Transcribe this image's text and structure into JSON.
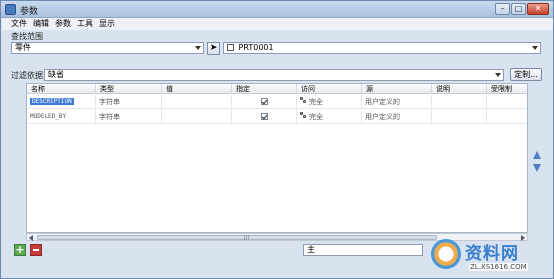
{
  "window": {
    "title": "参数"
  },
  "menu": [
    "文件",
    "编辑",
    "参数",
    "工具",
    "显示"
  ],
  "scope": {
    "label": "查找范围",
    "type_value": "零件",
    "model_value": "PRT0001"
  },
  "filter": {
    "label": "过滤依据",
    "value": "缺省",
    "custom_button": "定制..."
  },
  "table": {
    "columns": [
      "名称",
      "类型",
      "值",
      "指定",
      "访问",
      "源",
      "说明",
      "受限制"
    ],
    "rows": [
      {
        "name": "DESCRIPTION",
        "type": "字符串",
        "value": "",
        "designated": true,
        "access": "完全",
        "source": "用户定义的",
        "description": "",
        "restricted": ""
      },
      {
        "name": "MODELED_BY",
        "type": "字符串",
        "value": "",
        "designated": true,
        "access": "完全",
        "source": "用户定义的",
        "description": "",
        "restricted": ""
      }
    ]
  },
  "bottom": {
    "add_symbol": "+",
    "detail_value": "主"
  },
  "watermark": {
    "logo_text": "资料网",
    "url": "ZL.XS1616.COM"
  }
}
